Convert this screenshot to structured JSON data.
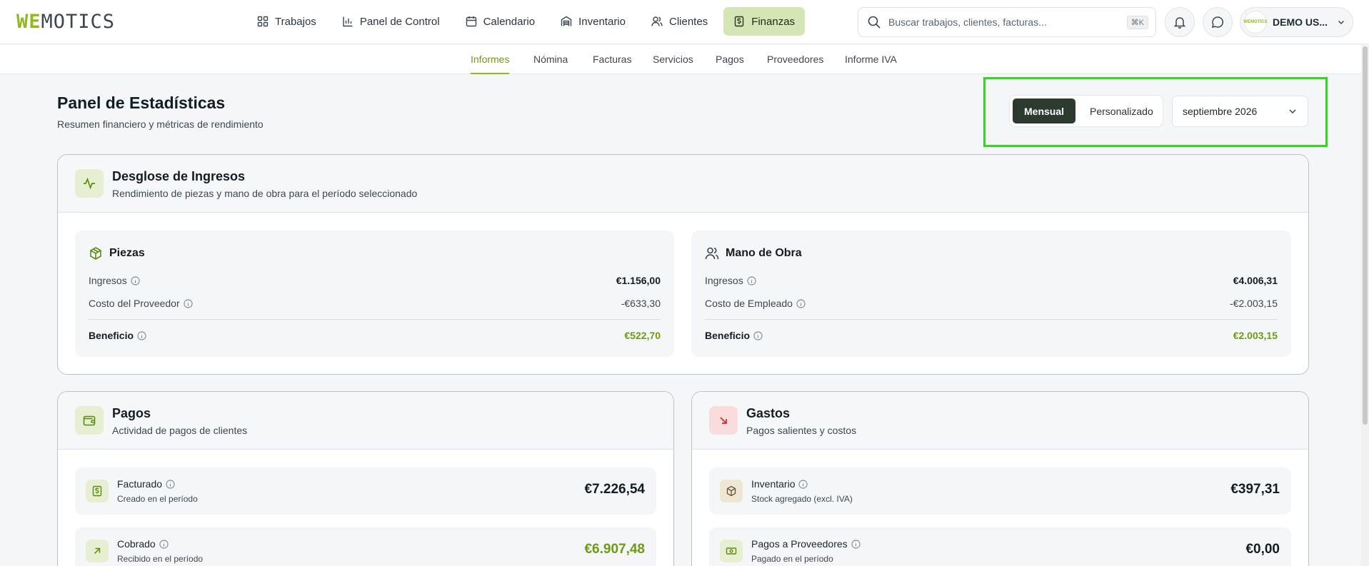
{
  "brand": {
    "logo_we": "WE",
    "logo_rest": "MOTICS",
    "avatar_text": "WEMOTICS"
  },
  "nav": [
    {
      "label": "Trabajos",
      "icon": "grid-icon"
    },
    {
      "label": "Panel de Control",
      "icon": "bar-chart-icon"
    },
    {
      "label": "Calendario",
      "icon": "calendar-icon"
    },
    {
      "label": "Inventario",
      "icon": "warehouse-icon"
    },
    {
      "label": "Clientes",
      "icon": "users-icon"
    },
    {
      "label": "Finanzas",
      "icon": "dollar-file-icon",
      "active": true
    }
  ],
  "search": {
    "placeholder": "Buscar trabajos, clientes, facturas...",
    "shortcut": "⌘K"
  },
  "user": {
    "name": "DEMO US..."
  },
  "subnav": [
    {
      "label": "Informes",
      "active": true
    },
    {
      "label": "Nómina"
    },
    {
      "label": "Facturas"
    },
    {
      "label": "Servicios"
    },
    {
      "label": "Pagos"
    },
    {
      "label": "Proveedores"
    },
    {
      "label": "Informe IVA"
    }
  ],
  "header": {
    "title": "Panel de Estadísticas",
    "subtitle": "Resumen financiero y métricas de rendimiento"
  },
  "period": {
    "options": [
      "Mensual",
      "Personalizado"
    ],
    "selected": "Mensual",
    "month": "septiembre 2026"
  },
  "revenue": {
    "title": "Desglose de Ingresos",
    "subtitle": "Rendimiento de piezas y mano de obra para el período seleccionado",
    "parts": {
      "title": "Piezas",
      "income_label": "Ingresos",
      "income": "€1.156,00",
      "cost_label": "Costo del Proveedor",
      "cost": "-€633,30",
      "profit_label": "Beneficio",
      "profit": "€522,70"
    },
    "labor": {
      "title": "Mano de Obra",
      "income_label": "Ingresos",
      "income": "€4.006,31",
      "cost_label": "Costo de Empleado",
      "cost": "-€2.003,15",
      "profit_label": "Beneficio",
      "profit": "€2.003,15"
    }
  },
  "payments": {
    "title": "Pagos",
    "subtitle": "Actividad de pagos de clientes",
    "items": [
      {
        "title": "Facturado",
        "sub": "Creado en el período",
        "value": "€7.226,54"
      },
      {
        "title": "Cobrado",
        "sub": "Recibido en el período",
        "value": "€6.907,48"
      }
    ]
  },
  "expenses": {
    "title": "Gastos",
    "subtitle": "Pagos salientes y costos",
    "items": [
      {
        "title": "Inventario",
        "sub": "Stock agregado (excl. IVA)",
        "value": "€397,31"
      },
      {
        "title": "Pagos a Proveedores",
        "sub": "Pagado en el período",
        "value": "€0,00"
      }
    ]
  },
  "colors": {
    "accent": "#8fba1d",
    "accent_text": "#6f9a13",
    "dark": "#2c3a30",
    "highlight": "#35d61f"
  }
}
